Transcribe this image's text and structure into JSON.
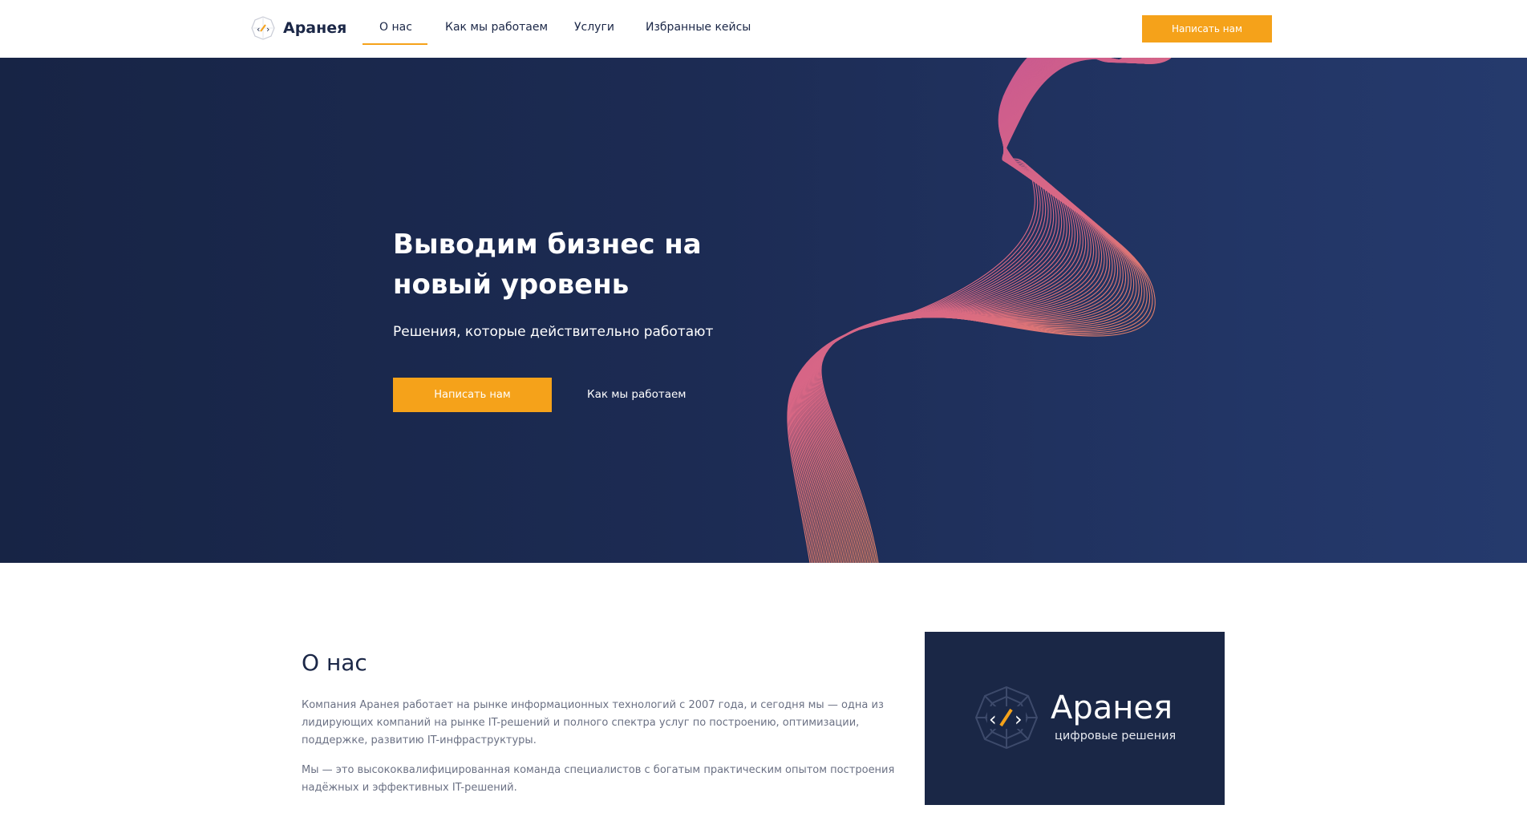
{
  "header": {
    "logo_text": "Аранея",
    "nav": [
      "О нас",
      "Как мы работаем",
      "Услуги",
      "Избранные кейсы"
    ],
    "active_nav": "О нас",
    "cta_label": "Написать нам"
  },
  "hero": {
    "title": "Выводим бизнес на новый уровень",
    "subtitle": "Решения, которые действительно работают",
    "primary_cta": "Написать нам",
    "secondary_link": "Как мы работаем"
  },
  "about": {
    "title": "О нас",
    "paragraph1": "Компания Аранея работает на рынке информационных технологий с 2007 года, и сегодня мы — одна из лидирующих компаний на рынке IT-решений и полного спектра услуг по построению, оптимизации, поддержке, развитию IT-инфраструктуры.",
    "paragraph2": "Мы — это высококвалифицированная команда специалистов с богатым практическим опытом построения надёжных и эффективных IT-решений.",
    "brand_name": "Аранея",
    "brand_tagline": "цифровые решения"
  },
  "colors": {
    "accent": "#f5a21a",
    "navy": "#1a2746",
    "wave_pink": "#d65fa5",
    "wave_orange": "#f4a63b"
  },
  "icons": [
    "aranea-logo-icon",
    "aranea-brand-icon"
  ]
}
